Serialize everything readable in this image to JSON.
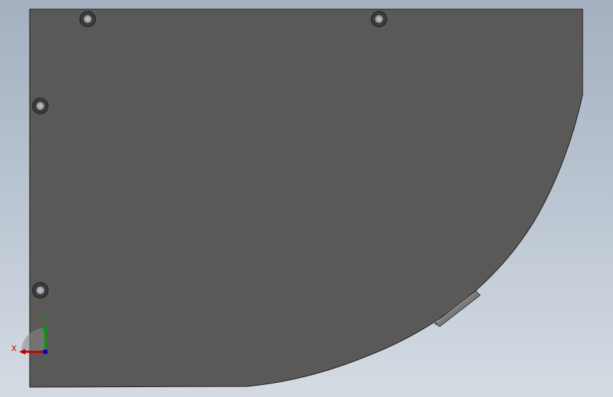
{
  "scene": {
    "background_top_color": "#a4b0c0",
    "background_bottom_color": "#d4dbe3",
    "part": {
      "face_color": "#5a5958",
      "edge_color": "#1a1a1a",
      "hole_count": 4
    }
  },
  "triad": {
    "x_label": "X",
    "y_label": "Y",
    "x_color": "#c00000",
    "y_color": "#00a000",
    "z_color": "#0000c0"
  }
}
